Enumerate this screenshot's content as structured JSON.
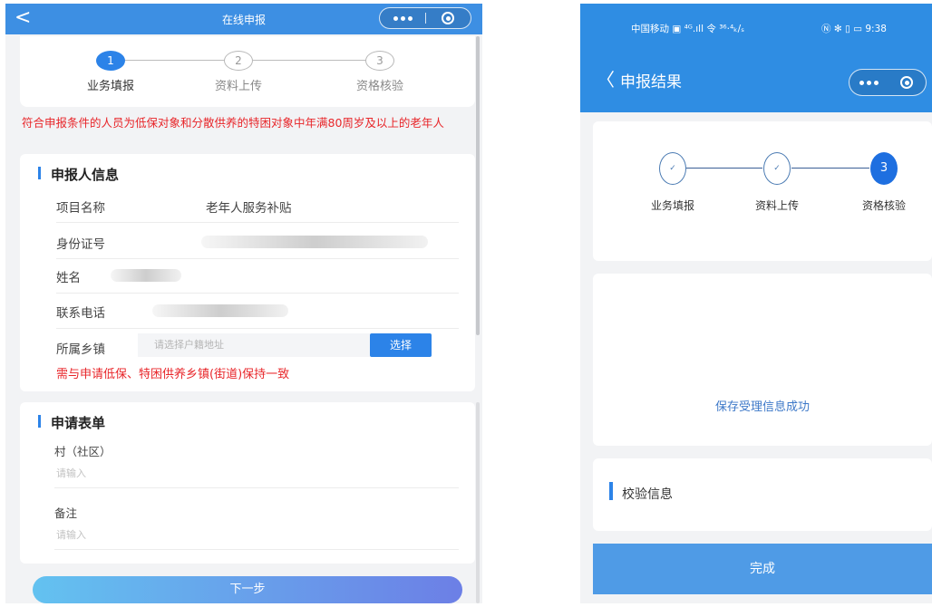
{
  "left": {
    "nav": {
      "back": "<",
      "title": "在线申报"
    },
    "steps": [
      {
        "number": "1",
        "label": "业务填报",
        "state": "active"
      },
      {
        "number": "2",
        "label": "资料上传",
        "state": "idle"
      },
      {
        "number": "3",
        "label": "资格核验",
        "state": "idle"
      }
    ],
    "notice": "符合申报条件的人员为低保对象和分散供养的特困对象中年满80周岁及以上的老年人",
    "applicant": {
      "title": "申报人信息",
      "project_label": "项目名称",
      "project_value": "老年人服务补贴",
      "id_label": "身份证号",
      "name_label": "姓名",
      "phone_label": "联系电话",
      "town_label": "所属乡镇",
      "town_placeholder": "请选择户籍地址",
      "select_button": "选择",
      "town_hint": "需与申请低保、特困供养乡镇(街道)保持一致"
    },
    "form": {
      "title": "申请表单",
      "village_label": "村（社区）",
      "village_placeholder": "请输入",
      "remark_label": "备注",
      "remark_placeholder": "请输入"
    },
    "next_button": "下一步"
  },
  "right": {
    "status": {
      "carrier": "中国移动 ▣ ⁴ᴳ.ıll 令 ³⁶·⁴ₖ/ₛ",
      "icons": "Ⓝ ✻ ▯ ▭ 9:38"
    },
    "nav": {
      "back": "〈",
      "title": "申报结果"
    },
    "steps": [
      {
        "number": "✓",
        "label": "业务填报",
        "state": "done"
      },
      {
        "number": "✓",
        "label": "资料上传",
        "state": "done"
      },
      {
        "number": "3",
        "label": "资格核验",
        "state": "active"
      }
    ],
    "result_message": "保存受理信息成功",
    "verify_title": "校验信息",
    "done_button": "完成"
  },
  "colors": {
    "primary": "#2c83e8",
    "warning": "#e8262a",
    "nav_blue": "#3d8fe3"
  }
}
